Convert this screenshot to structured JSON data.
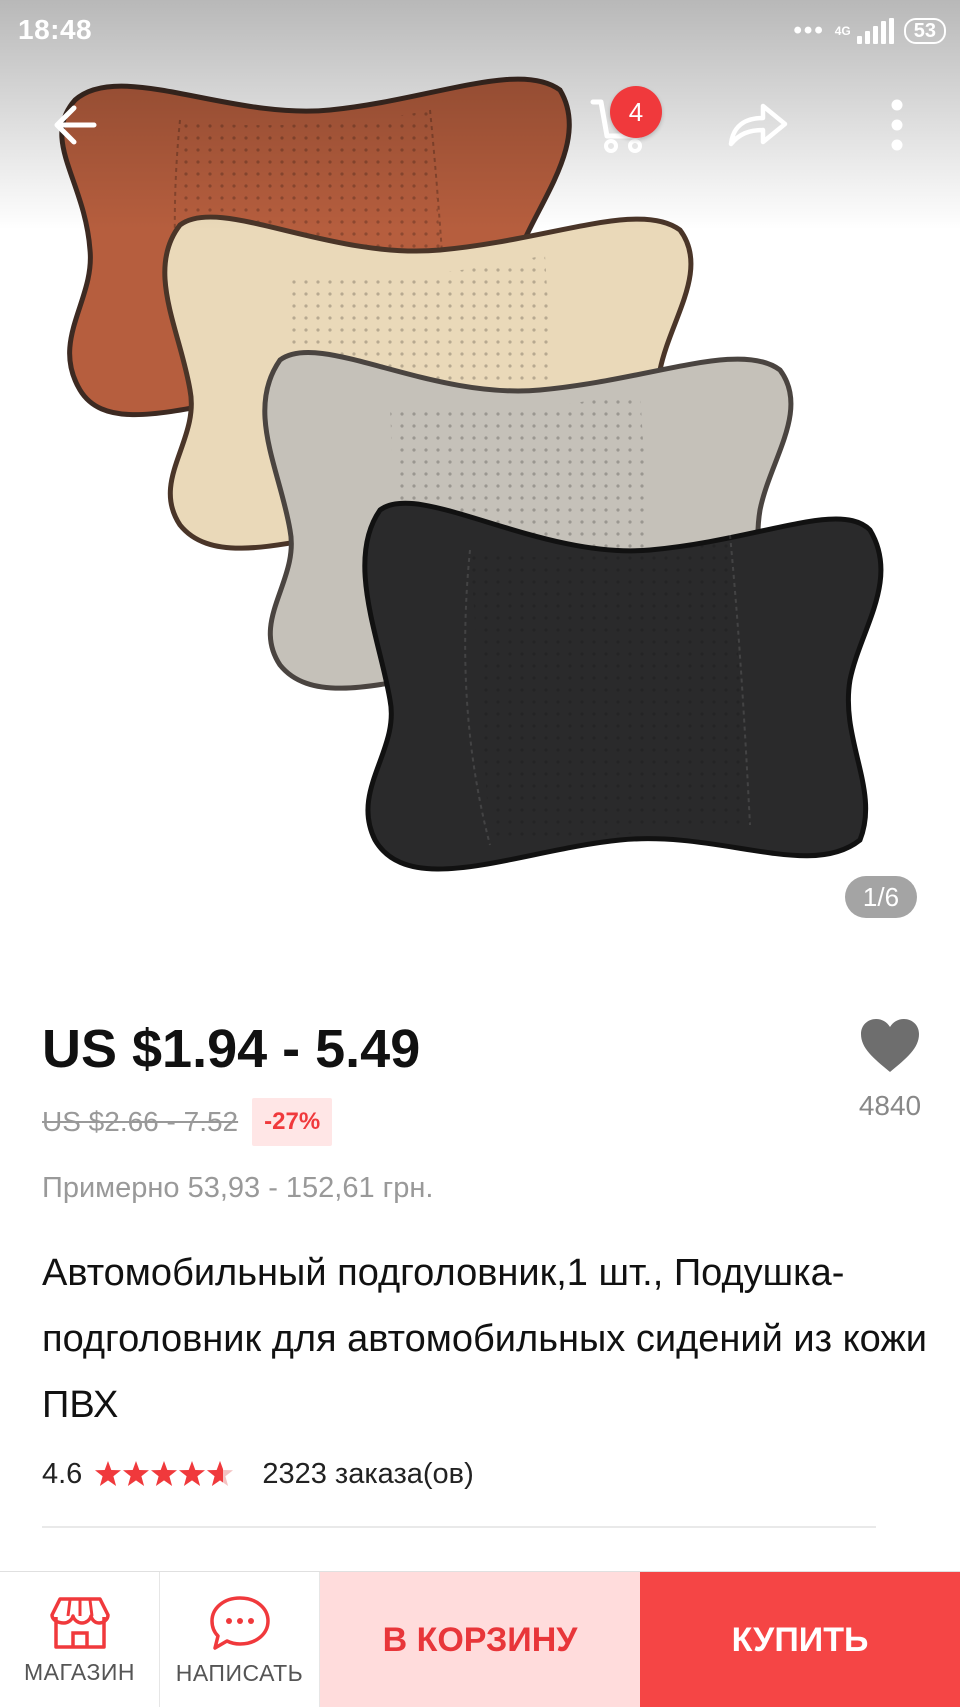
{
  "status_bar": {
    "time": "18:48",
    "dots": "•••",
    "network": "4G",
    "battery": "53"
  },
  "toolbar": {
    "cart_badge": "4"
  },
  "gallery": {
    "counter": "1/6",
    "product_colors": [
      "#b65e3e",
      "#ead9b9",
      "#c5c1b9",
      "#2a2a2b"
    ]
  },
  "product": {
    "price": "US $1.94 - 5.49",
    "old_price": "US $2.66 - 7.52",
    "discount": "-27%",
    "approx_price": "Примерно 53,93 - 152,61 грн.",
    "title": "Автомобильный подголовник,1 шт., Подушка-подголовник для автомобильных сидений из кожи ПВХ",
    "rating": "4.6",
    "rating_stars": 4.6,
    "orders": "2323 заказа(ов)",
    "favorites": "4840"
  },
  "bottom_bar": {
    "shop_label": "МАГАЗИН",
    "message_label": "НАПИСАТЬ",
    "add_to_cart": "В КОРЗИНУ",
    "buy": "КУПИТЬ"
  },
  "colors": {
    "accent": "#f54545",
    "accent_light": "#ffdcdc",
    "badge": "#f0393c"
  }
}
